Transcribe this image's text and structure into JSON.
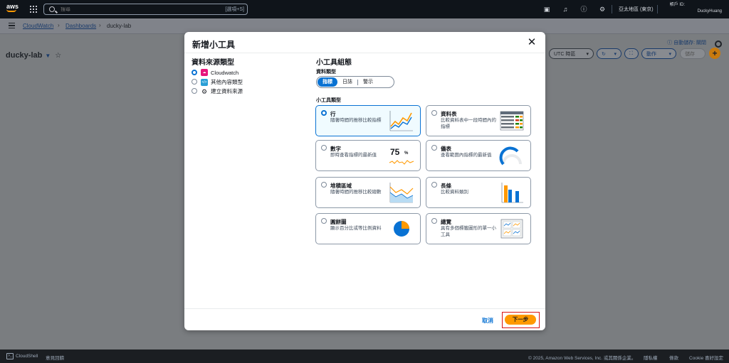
{
  "topnav": {
    "logo": "aws",
    "search_placeholder": "搜尋",
    "search_hint": "[選項+S]",
    "region": "亞太地區 (東京)",
    "account_label": "帳戶 ID:",
    "username": "DuckyHuang",
    "icons": [
      "grid-icon",
      "search-icon",
      "cloudshell-icon",
      "bell-icon",
      "help-icon",
      "gear-icon"
    ]
  },
  "breadcrumb": {
    "items": [
      "CloudWatch",
      "Dashboards",
      "ducky-lab"
    ]
  },
  "page": {
    "title": "ducky-lab",
    "autosave_label": "自動儲存: 關閉",
    "timezone_label": "UTC 時區",
    "actions_label": "動作",
    "save_label": "儲存"
  },
  "modal": {
    "title": "新增小工具",
    "data_source_heading": "資料來源類型",
    "data_sources": [
      {
        "label": "Cloudwatch",
        "selected": true,
        "icon": "cloudwatch-icon"
      },
      {
        "label": "其他內容類型",
        "selected": false,
        "icon": "code-icon"
      },
      {
        "label": "建立資料來源",
        "selected": false,
        "icon": "gear-icon"
      }
    ],
    "config_heading": "小工具組態",
    "data_type_label": "資料類型",
    "data_type_options": [
      "指標",
      "日誌",
      "警示"
    ],
    "data_type_selected": "指標",
    "widget_type_label": "小工具類型",
    "widgets": [
      {
        "title": "行",
        "desc": "隨著時間的推移比較指標",
        "selected": true,
        "icon": "line-chart-icon"
      },
      {
        "title": "資料表",
        "desc": "比較資料表中一段時間內的指標",
        "selected": false,
        "icon": "table-icon"
      },
      {
        "title": "數字",
        "desc": "即時查看指標的最新值",
        "selected": false,
        "icon": "number-icon",
        "sample": "75",
        "unit": "%"
      },
      {
        "title": "儀表",
        "desc": "查看範圍內指標的最新值",
        "selected": false,
        "icon": "gauge-icon"
      },
      {
        "title": "堆積區域",
        "desc": "隨著時間的推移比較總數",
        "selected": false,
        "icon": "stacked-area-icon"
      },
      {
        "title": "長條",
        "desc": "比較資料類別",
        "selected": false,
        "icon": "bar-chart-icon"
      },
      {
        "title": "圓餅圖",
        "desc": "顯示百分比或等比例資料",
        "selected": false,
        "icon": "pie-chart-icon"
      },
      {
        "title": "總覽",
        "desc": "具有多個標籤圖形的單一小工具",
        "selected": false,
        "icon": "explorer-icon"
      }
    ],
    "cancel_label": "取消",
    "next_label": "下一步"
  },
  "footer": {
    "cloudshell": "CloudShell",
    "feedback": "意見回饋",
    "copyright": "© 2025, Amazon Web Services, Inc. 或其關係企業。",
    "privacy": "隱私權",
    "terms": "條款",
    "cookie": "Cookie 喜好設定"
  },
  "colors": {
    "primary": "#0972d3",
    "accent": "#ff9900",
    "highlight_border": "#d91515"
  }
}
